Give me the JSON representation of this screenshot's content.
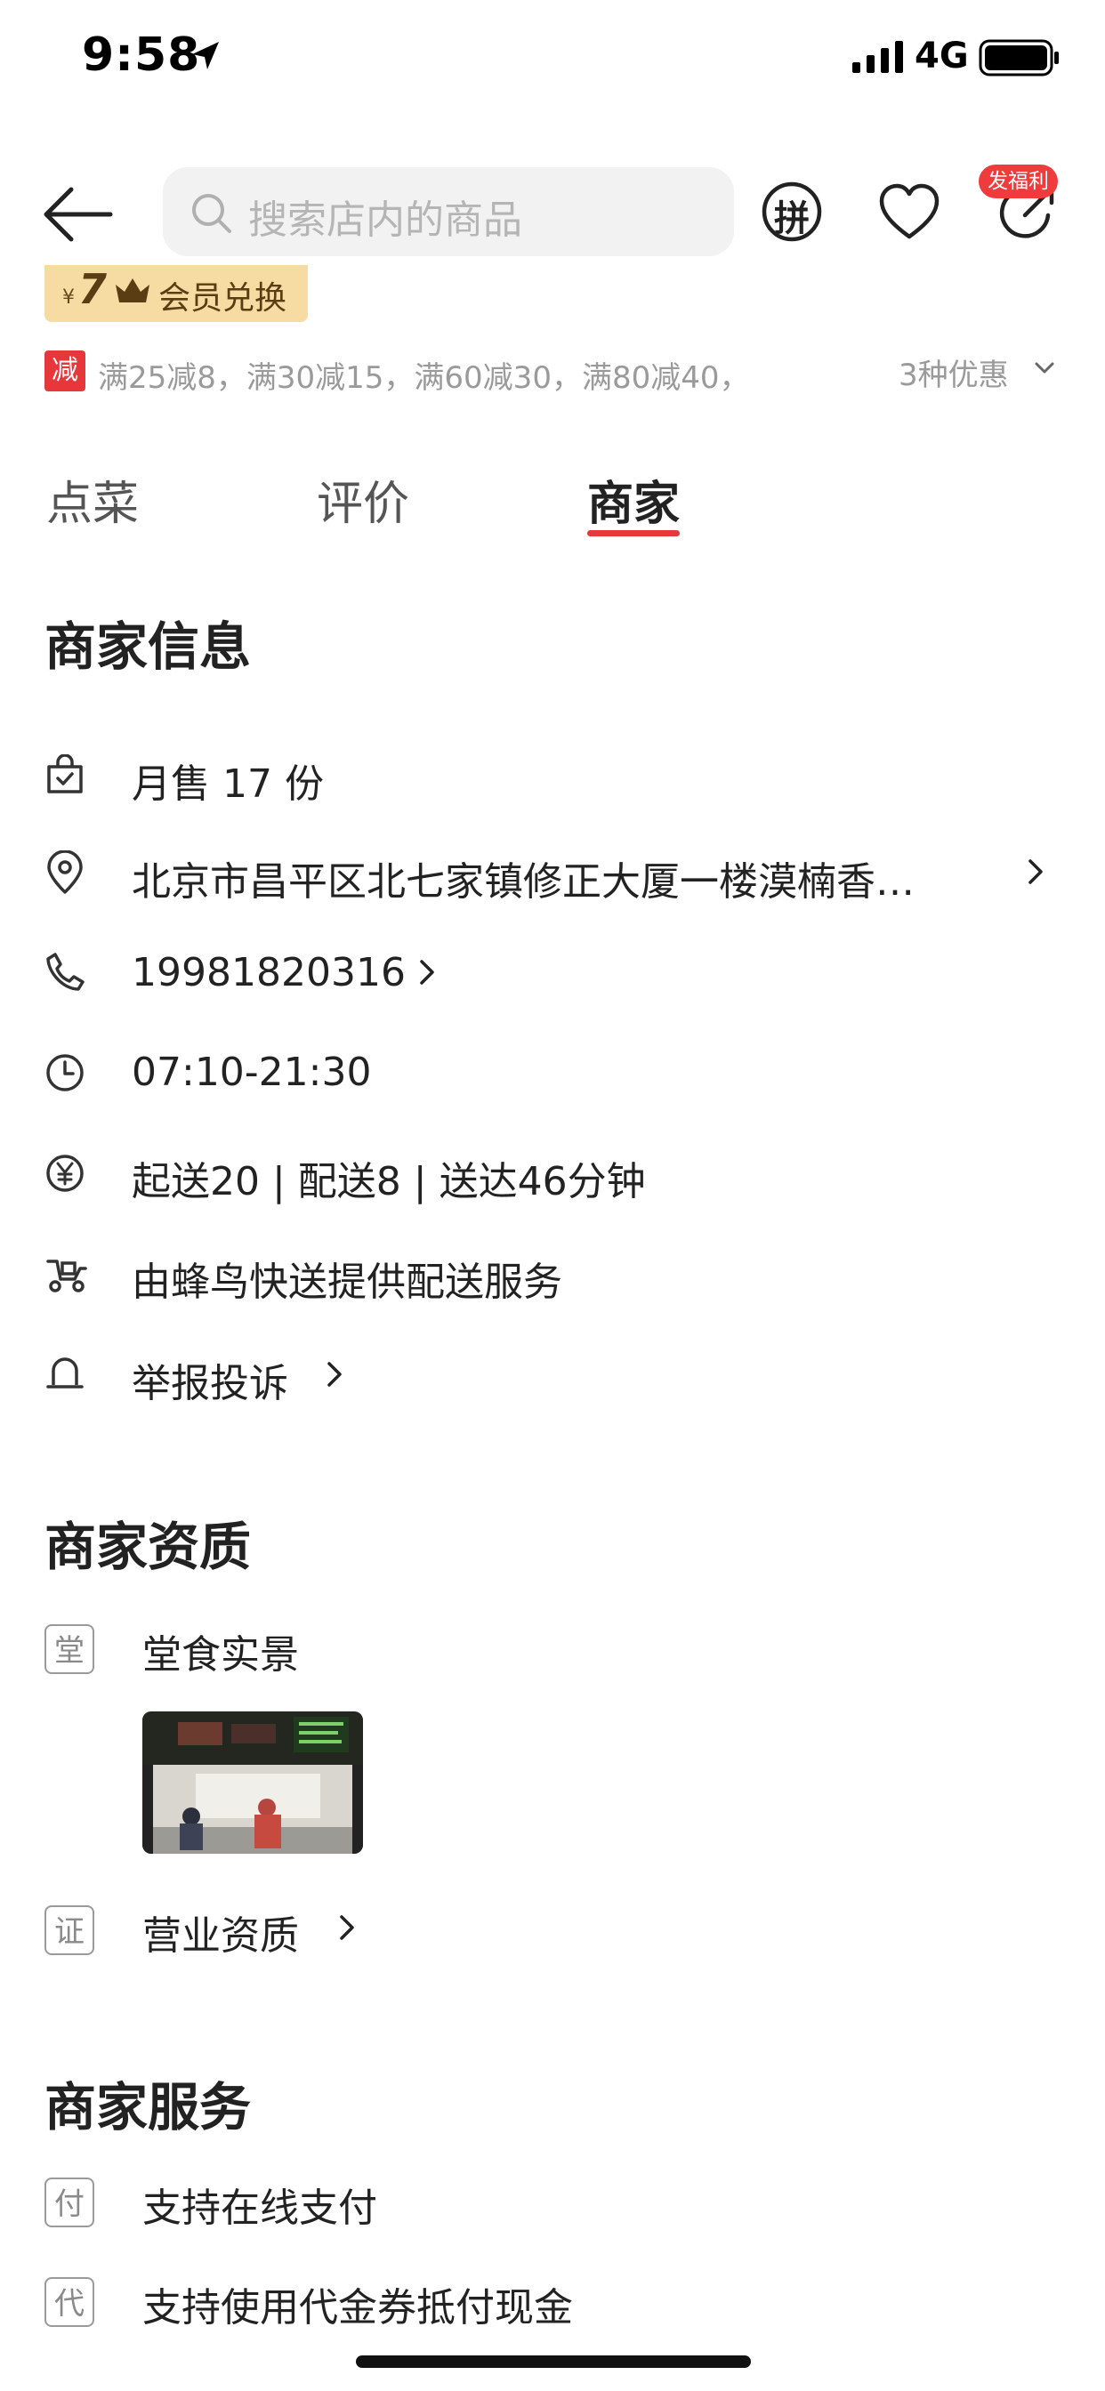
{
  "status_bar": {
    "time": "9:58",
    "network": "4G",
    "icons": [
      "location-arrow-icon",
      "signal-icon",
      "battery-icon"
    ]
  },
  "header": {
    "search_placeholder": "搜索店内的商品",
    "pin_icon_label": "拼",
    "welfare_badge": "发福利",
    "icons": [
      "back-arrow-icon",
      "search-icon",
      "heart-icon",
      "share-icon"
    ]
  },
  "member_exchange": {
    "currency": "¥",
    "price": "7",
    "label": "会员兑换"
  },
  "promo": {
    "badge": "减",
    "text": "满25减8，满30减15，满60减30，满80减40，",
    "more": "3种优惠"
  },
  "tabs": [
    {
      "label": "点菜",
      "active": false
    },
    {
      "label": "评价",
      "active": false
    },
    {
      "label": "商家",
      "active": true
    }
  ],
  "merchant_info": {
    "title": "商家信息",
    "monthly_sales": "月售 17 份",
    "address": "北京市昌平区北七家镇修正大厦一楼漠楠香…",
    "phone": "19981820316",
    "hours": "07:10-21:30",
    "delivery_fees": "起送20 | 配送8 | 送达46分钟",
    "delivery_service": "由蜂鸟快送提供配送服务",
    "report": "举报投诉"
  },
  "merchant_qualification": {
    "title": "商家资质",
    "dine_in_icon": "堂",
    "dine_in_label": "堂食实景",
    "license_icon": "证",
    "license_label": "营业资质"
  },
  "merchant_services": {
    "title": "商家服务",
    "pay_icon": "付",
    "pay_label": "支持在线支付",
    "voucher_icon": "代",
    "voucher_label": "支持使用代金券抵付现金"
  },
  "colors": {
    "accent_red": "#e8373b",
    "vip_gold": "#f6dba2",
    "search_bg": "#f2f2f2"
  }
}
